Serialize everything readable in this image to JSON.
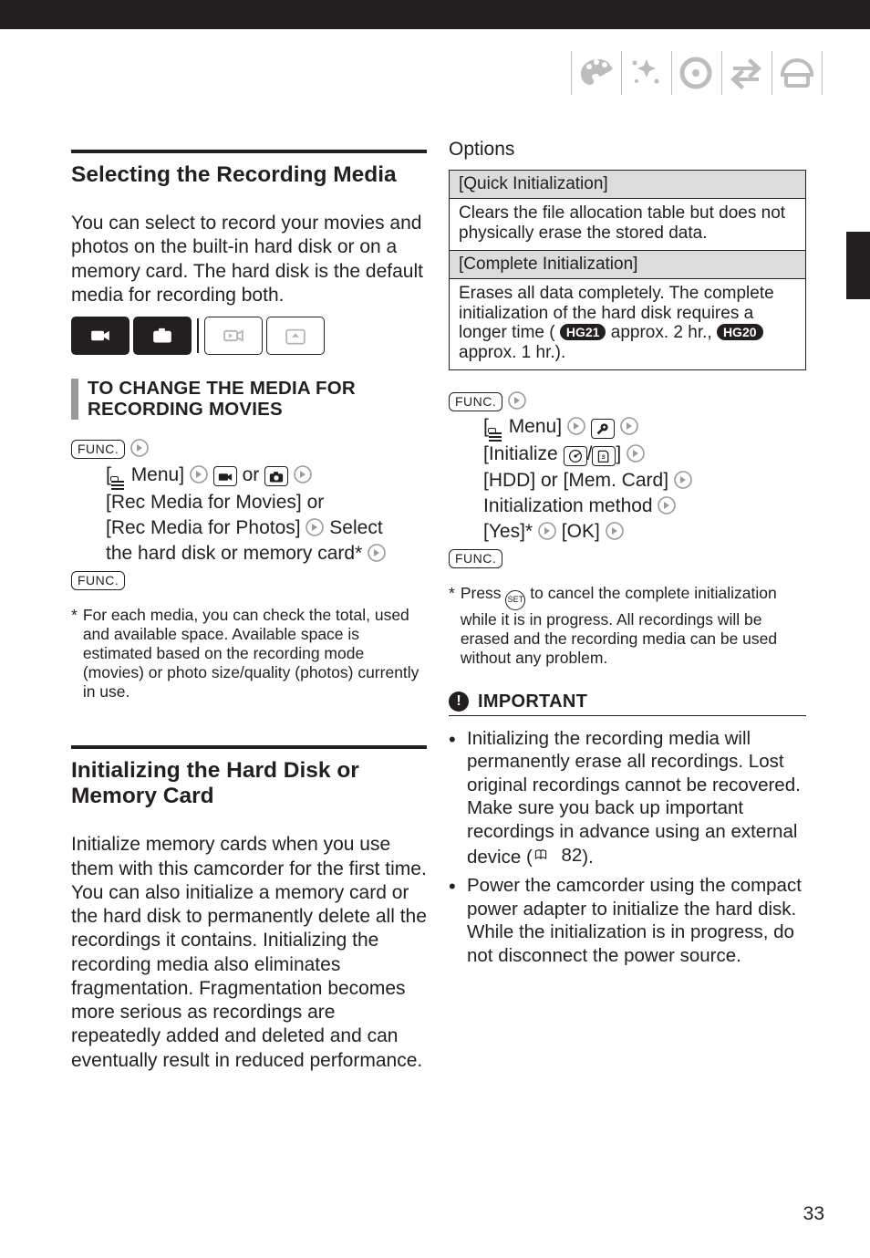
{
  "page_number": "33",
  "topbar_icons": [
    "palette-icon",
    "wand-icon",
    "disc-icon",
    "transfer-icon",
    "print-icon"
  ],
  "left": {
    "sect1_title": "Selecting the Recording Media",
    "sect1_body": "You can select to record your movies and photos on the built-in hard disk or on a memory card. The hard disk is the default media for recording both.",
    "subhead": "TO CHANGE THE MEDIA FOR RECORDING MOVIES",
    "func_label": "FUNC.",
    "steps": {
      "menu_label": "Menu",
      "or": "or",
      "line2a": "[Rec Media for Movies] or",
      "line3a": "[Rec Media for Photos]",
      "select": "Select",
      "line4": "the hard disk or memory card*"
    },
    "footnote": "For each media, you can check the total, used and available space. Available space is estimated based on the recording mode (movies) or photo size/quality (photos) currently in use.",
    "sect2_title": "Initializing the Hard Disk or Memory Card",
    "sect2_body": "Initialize memory cards when you use them with this camcorder for the first time. You can also initialize a memory card or the hard disk to permanently delete all the recordings it contains. Initializing the recording media also eliminates fragmentation. Fragmentation becomes more serious as recordings are repeatedly added and deleted and can eventually result in reduced performance."
  },
  "right": {
    "options_label": "Options",
    "rows": [
      {
        "title": "[Quick Initialization]",
        "body": "Clears the file allocation table but does not physically erase the stored data."
      },
      {
        "title": "[Complete Initialization]",
        "body_pre": "Erases all data completely. The complete initialization of the hard disk requires a longer time (",
        "pill1": "HG21",
        "mid1": " approx. 2 hr., ",
        "pill2": "HG20",
        "mid2": " approx. 1 hr.)."
      }
    ],
    "func_label": "FUNC.",
    "steps": {
      "menu_label": "Menu",
      "init_label": "Initialize",
      "slash": "/",
      "hdd": "[HDD] or [Mem. Card]",
      "method": "Initialization method",
      "yes": "[Yes]*",
      "ok": "[OK]"
    },
    "footnote_pre": "Press ",
    "set_label": "SET",
    "footnote_post": " to cancel the complete initialization while it is in progress. All recordings will be erased and the recording media can be used without any problem.",
    "important_label": "IMPORTANT",
    "bullets": [
      {
        "pre": "Initializing the recording media will permanently erase all recordings. Lost original recordings cannot be recovered. Make sure you back up important recordings in advance using an external device (",
        "ref": "82",
        "post": ")."
      },
      {
        "pre": "Power the camcorder using the compact power adapter to initialize the hard disk. While the initialization is in progress, do not disconnect the power source."
      }
    ]
  }
}
